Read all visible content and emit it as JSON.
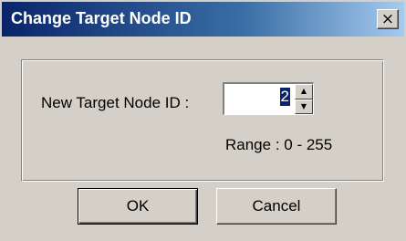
{
  "window": {
    "title": "Change Target Node ID",
    "close_glyph": "×",
    "titlebar_color": "#0a246a"
  },
  "form": {
    "label": "New Target Node ID :",
    "value": "2",
    "spin_up_glyph": "▲",
    "spin_down_glyph": "▼",
    "range_text": "Range : 0 - 255"
  },
  "buttons": {
    "ok": "OK",
    "cancel": "Cancel"
  },
  "icons": {
    "close": "close-icon",
    "spin_up": "chevron-up-icon",
    "spin_down": "chevron-down-icon"
  }
}
